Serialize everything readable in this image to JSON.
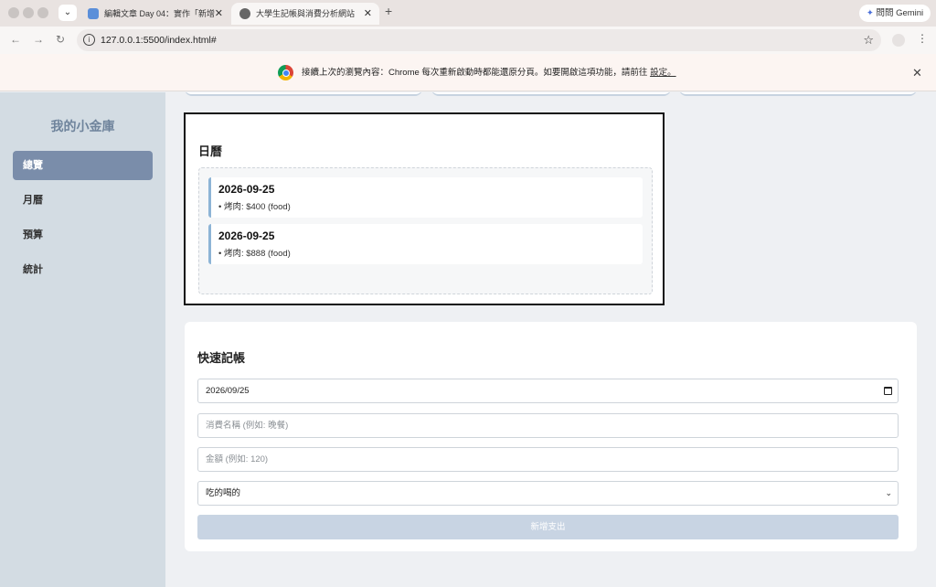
{
  "browser": {
    "tabs": [
      {
        "title": "編輯文章 Day 04：實作「新增",
        "active": false
      },
      {
        "title": "大學生記帳與消費分析網站",
        "active": true
      }
    ],
    "gemini_label": "問問 Gemini",
    "url": "127.0.0.1:5500/index.html#"
  },
  "infobar": {
    "message": "接續上次的瀏覽內容：Chrome 每次重新啟動時都能還原分頁。如要開啟這項功能，請前往",
    "link": "設定。"
  },
  "sidebar": {
    "brand": "我的小金庫",
    "items": [
      {
        "label": "總覽",
        "active": true
      },
      {
        "label": "月曆",
        "active": false
      },
      {
        "label": "預算",
        "active": false
      },
      {
        "label": "統計",
        "active": false
      }
    ]
  },
  "calendar": {
    "title": "日曆",
    "entries": [
      {
        "date": "2026-09-25",
        "item": "• 烤肉: $400 (food)"
      },
      {
        "date": "2026-09-25",
        "item": "• 烤肉: $888 (food)"
      }
    ]
  },
  "quick_entry": {
    "title": "快速記帳",
    "date_value": "2026/09/25",
    "name_placeholder": "消費名稱 (例如: 晚餐)",
    "amount_placeholder": "金額 (例如: 120)",
    "category_value": "吃的喝的",
    "submit_label": "新增支出"
  },
  "colors": {
    "sidebar_bg": "#d3dce3",
    "active_nav": "#7a8daa",
    "brand_text": "#6f849c",
    "entry_accent": "#8db4d6",
    "submit_bg": "#c8d4e3"
  }
}
